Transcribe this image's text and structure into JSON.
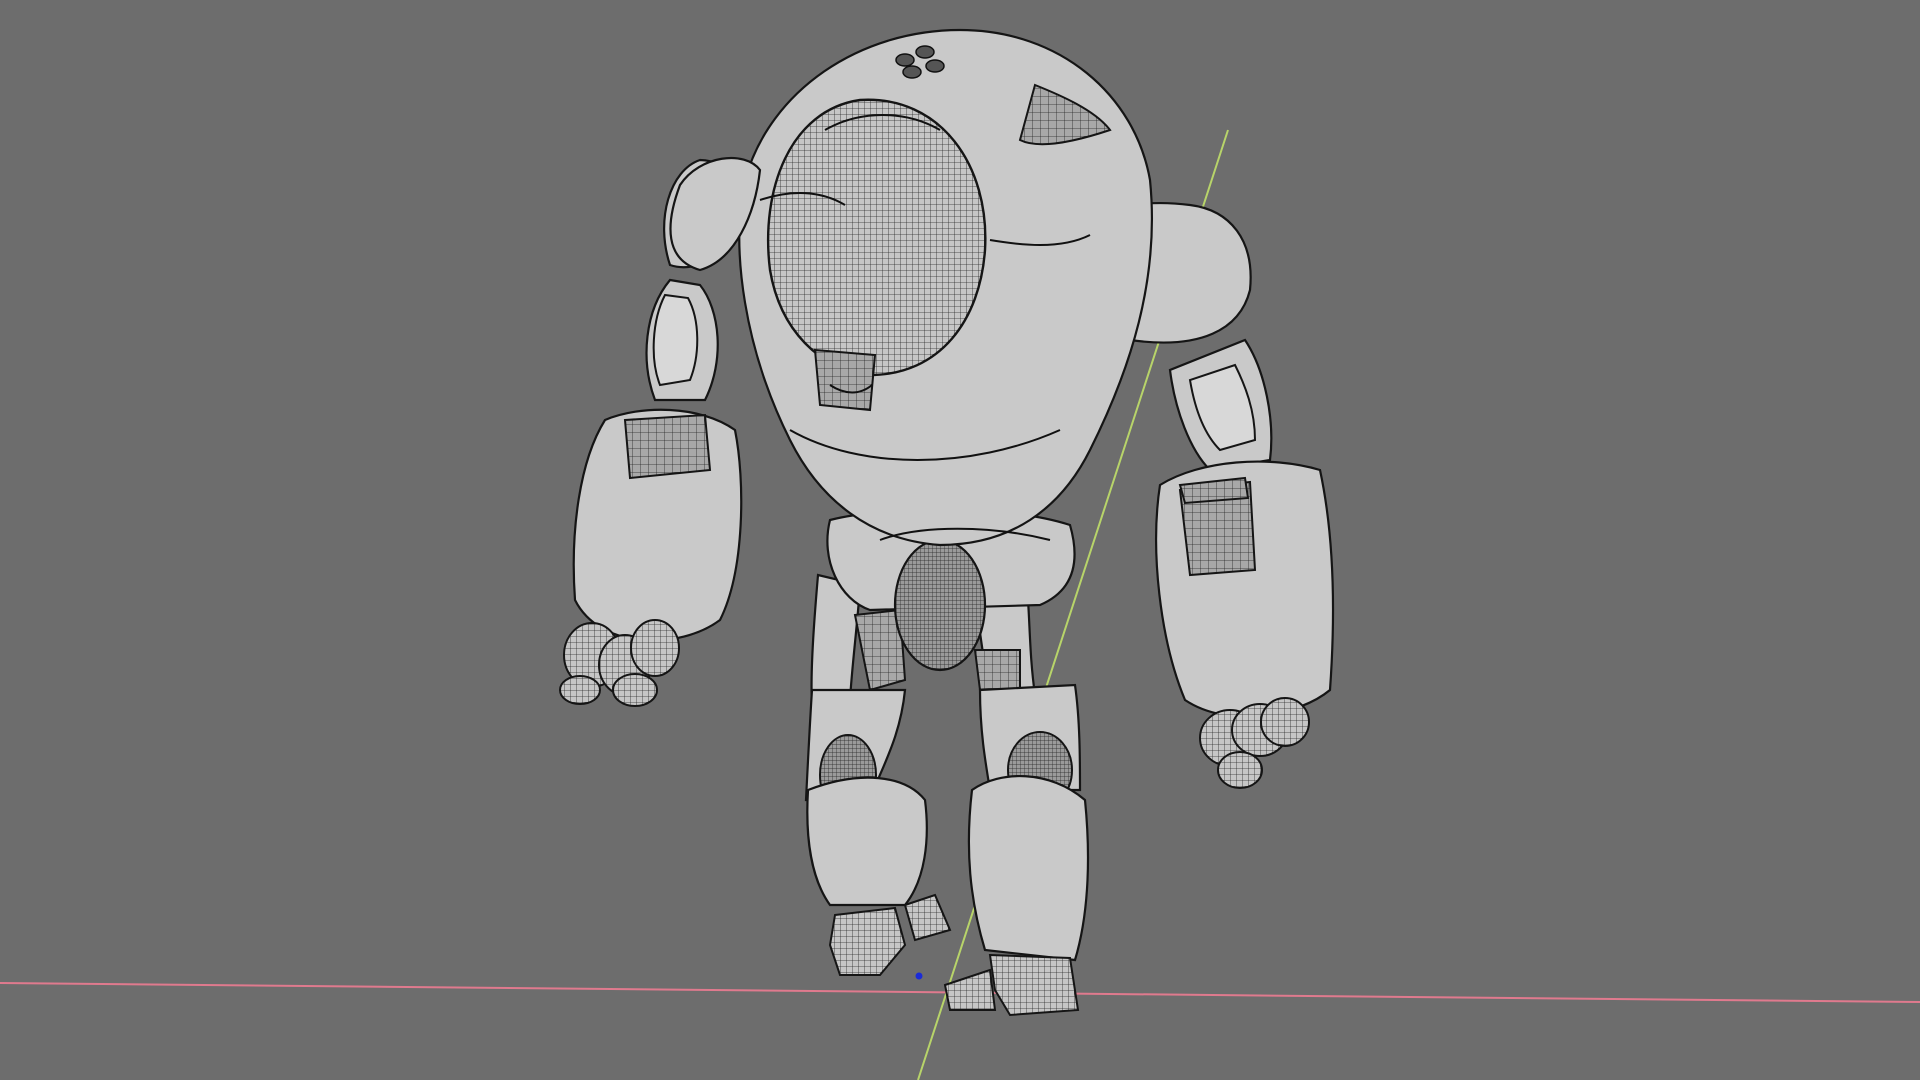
{
  "viewport": {
    "background": "#6d6d6d",
    "shading_mode": "wireframe-over-solid",
    "object": "robot-character-mesh",
    "axis_colors": {
      "x_axis": "#e07a8e",
      "y_axis": "#b8d46a"
    },
    "origin_marker_color": "#1a2bd8"
  }
}
